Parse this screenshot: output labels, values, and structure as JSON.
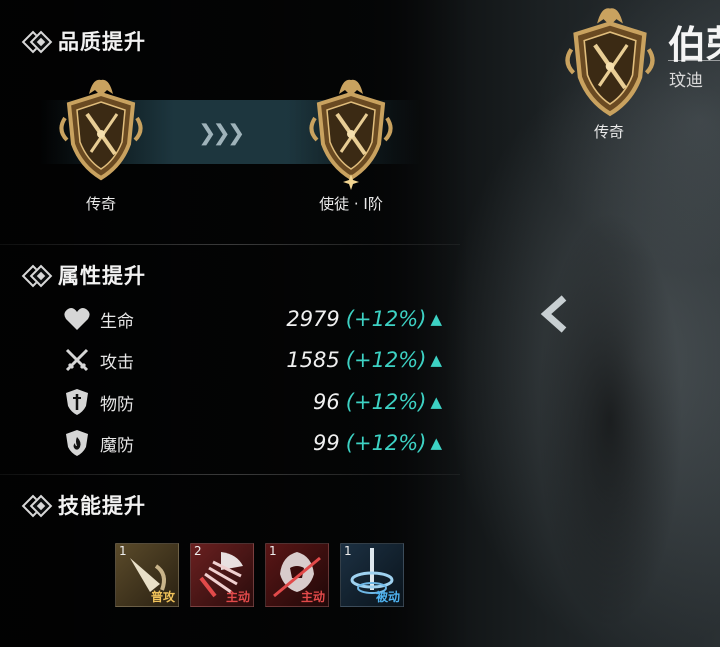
{
  "colors": {
    "gold": "#c9a25f",
    "teal": "#3dd2c4",
    "active_red": "#e24a4a",
    "passive_blue": "#4fb3f0"
  },
  "quality": {
    "title": "品质提升",
    "from_label": "传奇",
    "to_label": "使徒 · Ⅰ阶",
    "arrow_icon": "triple-chevron-right"
  },
  "attributes": {
    "title": "属性提升",
    "stats": [
      {
        "name": "生命",
        "icon": "heart-icon",
        "value": "2979",
        "bonus": "(+12%)",
        "trend": "▲"
      },
      {
        "name": "攻击",
        "icon": "crossed-swords-icon",
        "value": "1585",
        "bonus": "(+12%)",
        "trend": "▲"
      },
      {
        "name": "物防",
        "icon": "shield-sword-icon",
        "value": "96",
        "bonus": "(+12%)",
        "trend": "▲"
      },
      {
        "name": "魔防",
        "icon": "shield-flame-icon",
        "value": "99",
        "bonus": "(+12%)",
        "trend": "▲"
      }
    ]
  },
  "skills": {
    "title": "技能提升",
    "items": [
      {
        "level": "1",
        "tag": "普攻",
        "tag_color": "#f0c25a"
      },
      {
        "level": "2",
        "tag": "主动",
        "tag_color": "#e24a4a"
      },
      {
        "level": "1",
        "tag": "主动",
        "tag_color": "#e24a4a"
      },
      {
        "level": "1",
        "tag": "被动",
        "tag_color": "#4fb3f0"
      }
    ]
  },
  "hero": {
    "name": "伯荣",
    "subtitle": "玟迪",
    "rank_label": "传奇"
  }
}
